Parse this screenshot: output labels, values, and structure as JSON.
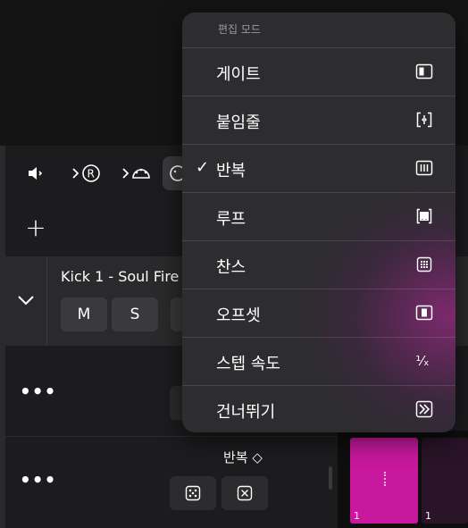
{
  "track": {
    "name": "Kick 1 - Soul Fire",
    "mute_label": "M",
    "solo_label": "S"
  },
  "toolbar": {
    "icons": [
      "speaker-icon",
      "record-arm-icon",
      "midi-icon",
      "settings-icon"
    ]
  },
  "add_label": "+",
  "rows": [
    {
      "more_label": "•••"
    },
    {
      "more_label": "•••",
      "mode_label": "반복 ◇"
    }
  ],
  "steps": [
    {
      "number": "1",
      "color": "#c8189e"
    },
    {
      "number": "1",
      "color": "#2a1428"
    }
  ],
  "menu": {
    "header": "편집 모드",
    "items": [
      {
        "label": "게이트",
        "checked": false,
        "icon": "gate-icon"
      },
      {
        "label": "붙임줄",
        "checked": false,
        "icon": "tie-icon"
      },
      {
        "label": "반복",
        "checked": true,
        "icon": "repeat-icon"
      },
      {
        "label": "루프",
        "checked": false,
        "icon": "loop-icon"
      },
      {
        "label": "찬스",
        "checked": false,
        "icon": "chance-icon"
      },
      {
        "label": "오프셋",
        "checked": false,
        "icon": "offset-icon"
      },
      {
        "label": "스텝 속도",
        "checked": false,
        "icon": "step-rate-icon"
      },
      {
        "label": "건너뛰기",
        "checked": false,
        "icon": "skip-icon"
      }
    ],
    "check_glyph": "✓",
    "step_rate_glyph": "¹⁄ₓ"
  }
}
